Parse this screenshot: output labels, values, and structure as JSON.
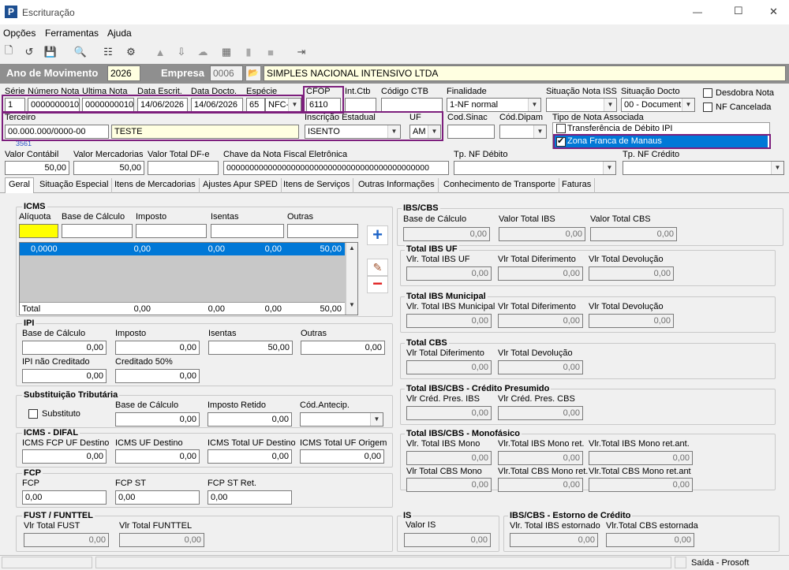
{
  "window": {
    "title": "Escrituração",
    "min": "—",
    "max": "☐",
    "close": "✕"
  },
  "menu": [
    "Opções",
    "Ferramentas",
    "Ajuda"
  ],
  "yearbar": {
    "ano_label": "Ano de Movimento",
    "ano": "2026",
    "empresa_label": "Empresa",
    "empresa_code": "0006",
    "empresa_name": "SIMPLES NACIONAL INTENSIVO LTDA"
  },
  "header": {
    "serie_l": "Série",
    "serie": "1",
    "numero_l": "Número Nota",
    "numero": "0000000010",
    "ultima_l": "Ultima Nota",
    "ultima": "0000000010",
    "data_escrit_l": "Data Escrit.",
    "data_escrit": "14/06/2026",
    "data_docto_l": "Data Docto.",
    "data_docto": "14/06/2026",
    "especie_l": "Espécie",
    "especie_code": "65",
    "especie_name": "NFC-E",
    "cfop_l": "CFOP",
    "cfop": "6110",
    "intctb_l": "Int.Ctb",
    "codctb_l": "Código CTB",
    "finalidade_l": "Finalidade",
    "finalidade": "1-NF normal",
    "sitiss_l": "Situação Nota ISS",
    "sitdocto_l": "Situação Docto",
    "sitdocto": "00 - Document",
    "desdobra": "Desdobra Nota",
    "nfcancelada": "NF Cancelada",
    "terceiro_l": "Terceiro",
    "terceiro_doc": "00.000.000/0000-00",
    "terceiro_nome": "TESTE",
    "terceiro_sub": "3561",
    "ie_l": "Inscrição Estadual",
    "ie": "ISENTO",
    "uf_l": "UF",
    "uf": "AM",
    "codsinac_l": "Cod.Sinac",
    "coddipam_l": "Cód.Dipam",
    "tiponota_l": "Tipo de Nota Associada",
    "tipo_opt1": "Transferência de Débito IPI",
    "tipo_opt2": "Zona Franca de Manaus",
    "vcontabil_l": "Valor Contábil",
    "vcontabil": "50,00",
    "vmerc_l": "Valor Mercadorias",
    "vmerc": "50,00",
    "vdfe_l": "Valor Total DF-e",
    "chave_l": "Chave da Nota Fiscal Eletrônica",
    "chave": "00000000000000000000000000000000000000000000",
    "tpdeb_l": "Tp. NF Débito",
    "tpcred_l": "Tp. NF Crédito"
  },
  "tabs": [
    "Geral",
    "Situação Especial",
    "Itens de Mercadorias",
    "Ajustes Apur SPED",
    "Itens de Serviços",
    "Outras Informações",
    "Conhecimento de Transporte",
    "Faturas"
  ],
  "icms": {
    "title": "ICMS",
    "aliq_l": "Alíquota",
    "bc_l": "Base de Cálculo",
    "imp_l": "Imposto",
    "ise_l": "Isentas",
    "out_l": "Outras",
    "row": [
      "0,0000",
      "0,00",
      "0,00",
      "0,00",
      "50,00"
    ],
    "total_l": "Total",
    "total": [
      "0,00",
      "0,00",
      "0,00",
      "50,00"
    ]
  },
  "ipi": {
    "title": "IPI",
    "bc_l": "Base de Cálculo",
    "bc": "0,00",
    "imp_l": "Imposto",
    "imp": "0,00",
    "ise_l": "Isentas",
    "ise": "50,00",
    "out_l": "Outras",
    "out": "0,00",
    "nc_l": "IPI não Creditado",
    "nc": "0,00",
    "c50_l": "Creditado 50%",
    "c50": "0,00"
  },
  "st": {
    "title": "Substituição Tributária",
    "sub_l": "Substituto",
    "bc_l": "Base de Cálculo",
    "bc": "0,00",
    "ir_l": "Imposto Retido",
    "ir": "0,00",
    "ca_l": "Cód.Antecip."
  },
  "difal": {
    "title": "ICMS - DIFAL",
    "a_l": "ICMS FCP UF Destino",
    "a": "0,00",
    "b_l": "ICMS UF Destino",
    "b": "0,00",
    "c_l": "ICMS Total UF Destino",
    "c": "0,00",
    "d_l": "ICMS Total UF Origem",
    "d": "0,00"
  },
  "fcp": {
    "title": "FCP",
    "a_l": "FCP",
    "a": "0,00",
    "b_l": "FCP ST",
    "b": "0,00",
    "c_l": "FCP ST Ret.",
    "c": "0,00"
  },
  "fust": {
    "title": "FUST / FUNTTEL",
    "a_l": "Vlr Total FUST",
    "a": "0,00",
    "b_l": "Vlr Total FUNTTEL",
    "b": "0,00"
  },
  "ibscbs": {
    "title": "IBS/CBS",
    "bc_l": "Base de Cálculo",
    "bc": "0,00",
    "ibs_l": "Valor Total IBS",
    "ibs": "0,00",
    "cbs_l": "Valor Total CBS",
    "cbs": "0,00"
  },
  "ibsuf": {
    "title": "Total IBS UF",
    "a_l": "Vlr. Total IBS UF",
    "a": "0,00",
    "b_l": "Vlr Total Diferimento",
    "b": "0,00",
    "c_l": "Vlr Total Devolução",
    "c": "0,00"
  },
  "ibsmun": {
    "title": "Total IBS Municipal",
    "a_l": "Vlr. Total IBS Municipal",
    "a": "0,00",
    "b_l": "Vlr Total Diferimento",
    "b": "0,00",
    "c_l": "Vlr Total Devolução",
    "c": "0,00"
  },
  "tcbs": {
    "title": "Total CBS",
    "a_l": "Vlr Total Diferimento",
    "a": "0,00",
    "b_l": "Vlr Total Devolução",
    "b": "0,00"
  },
  "cp": {
    "title": "Total IBS/CBS - Crédito Presumido",
    "a_l": "Vlr Créd. Pres. IBS",
    "a": "0,00",
    "b_l": "Vlr Créd. Pres. CBS",
    "b": "0,00"
  },
  "mono": {
    "title": "Total IBS/CBS - Monofásico",
    "a_l": "Vlr. Total IBS Mono",
    "a": "0,00",
    "b_l": "Vlr.Total IBS Mono ret.",
    "b": "0,00",
    "c_l": "Vlr.Total IBS Mono ret.ant.",
    "c": "0,00",
    "d_l": "Vlr Total CBS Mono",
    "d": "0,00",
    "e_l": "Vlr.Total CBS Mono ret.",
    "e": "0,00",
    "f_l": "Vlr.Total CBS Mono ret.ant",
    "f": "0,00"
  },
  "is": {
    "title": "IS",
    "a_l": "Valor IS",
    "a": "0,00"
  },
  "estorno": {
    "title": "IBS/CBS - Estorno de Crédito",
    "a_l": "Vlr. Total IBS estornado",
    "a": "0,00",
    "b_l": "Vlr.Total CBS estornada",
    "b": "0,00"
  },
  "status": {
    "text": "Saída - Prosoft"
  }
}
